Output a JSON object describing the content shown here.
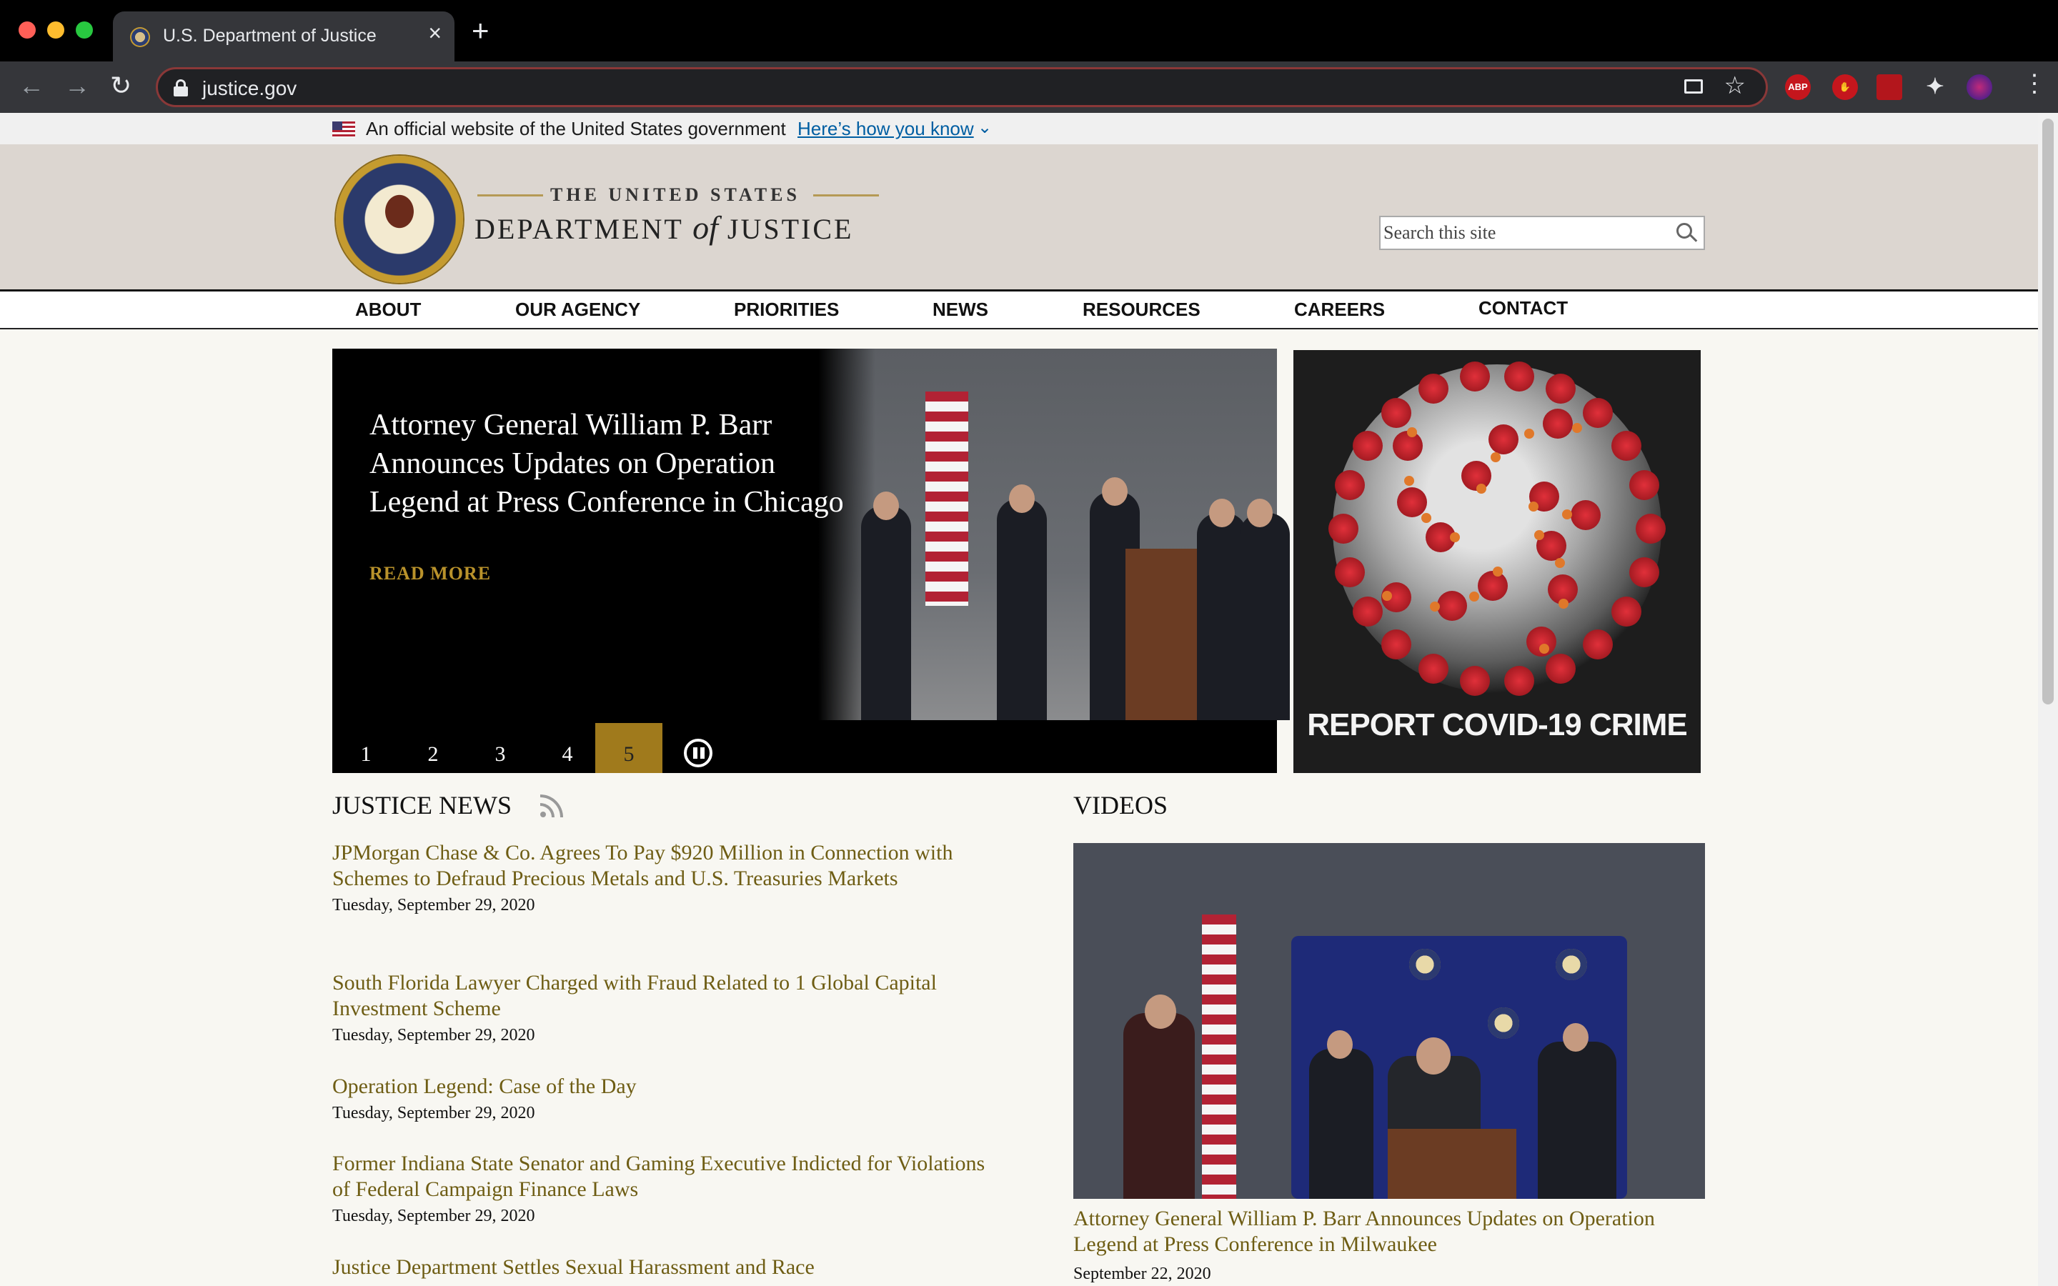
{
  "browser": {
    "tab_title": "U.S. Department of Justice",
    "url": "justice.gov",
    "extensions": [
      "ABP"
    ]
  },
  "gov_banner": {
    "text": "An official website of the United States government",
    "link": "Here’s how you know"
  },
  "masthead": {
    "logo_top": "THE UNITED STATES",
    "logo_dept": "DEPARTMENT",
    "logo_of": "of",
    "logo_justice": "JUSTICE",
    "search_placeholder": "Search this site"
  },
  "nav": {
    "items": [
      "ABOUT",
      "OUR AGENCY",
      "PRIORITIES",
      "NEWS",
      "RESOURCES",
      "CAREERS",
      "CONTACT"
    ]
  },
  "hero": {
    "title": "Attorney General William P. Barr Announces Updates on Operation Legend at Press Conference in Chicago",
    "read_more": "READ MORE",
    "pages": [
      "1",
      "2",
      "3",
      "4",
      "5"
    ],
    "active_page": 5
  },
  "promo": {
    "label": "REPORT COVID-19 CRIME"
  },
  "news": {
    "heading": "JUSTICE NEWS",
    "items": [
      {
        "title": "JPMorgan Chase & Co. Agrees To Pay $920 Million in Connection with Schemes to Defraud Precious Metals and U.S. Treasuries Markets",
        "date": "Tuesday, September 29, 2020"
      },
      {
        "title": "South Florida Lawyer Charged with Fraud Related to 1 Global Capital Investment Scheme",
        "date": "Tuesday, September 29, 2020"
      },
      {
        "title": "Operation Legend: Case of the Day",
        "date": "Tuesday, September 29, 2020"
      },
      {
        "title": "Former Indiana State Senator and Gaming Executive Indicted for Violations of Federal Campaign Finance Laws",
        "date": "Tuesday, September 29, 2020"
      },
      {
        "title": "Justice Department Settles Sexual Harassment and Race",
        "date": ""
      }
    ]
  },
  "videos": {
    "heading": "VIDEOS",
    "title": "Attorney General William P. Barr Announces Updates on Operation Legend at Press Conference in Milwaukee",
    "date": "September 22, 2020"
  },
  "colors": {
    "accent_gold": "#a07a1c",
    "link_olive": "#6e5d14",
    "masthead_bg": "#dcd6d0",
    "gov_link_blue": "#005ea2"
  }
}
